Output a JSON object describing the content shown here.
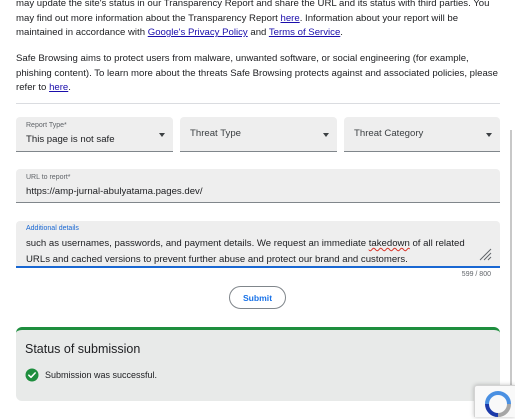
{
  "intro": {
    "text1": "may update the site's status in our Transparency Report and share the URL and its status with third parties. You may find out more information about the Transparency Report ",
    "link1": "here",
    "text2": ". Information about your report will be maintained in accordance with ",
    "link2": "Google's Privacy Policy",
    "text3": " and ",
    "link3": "Terms of Service",
    "text4": "."
  },
  "safe_browsing": {
    "text1": "Safe Browsing aims to protect users from malware, unwanted software, or social engineering (for example, phishing content). To learn more about the threats Safe Browsing protects against and associated policies, please refer to ",
    "link": "here",
    "text2": "."
  },
  "form": {
    "report_type": {
      "label": "Report Type*",
      "value": "This page is not safe"
    },
    "threat_type": {
      "placeholder": "Threat Type"
    },
    "threat_category": {
      "placeholder": "Threat Category"
    },
    "url": {
      "label": "URL to report*",
      "value": "https://amp-jurnal-abulyatama.pages.dev/"
    },
    "details": {
      "label": "Additional details",
      "value_part1": "such as usernames, passwords, and payment details. We request an immediate ",
      "value_misspelled": "takedown",
      "value_part2": " of all related URLs and cached versions to prevent further abuse and protect our brand and customers.",
      "counter": "599 / 800"
    },
    "submit_label": "Submit"
  },
  "status": {
    "title": "Status of submission",
    "message": "Submission was successful."
  },
  "colors": {
    "link": "#1a0dab",
    "accent": "#1a73e8",
    "success": "#1e8e3e"
  },
  "icons": [
    "dropdown-arrow-icon",
    "resize-handle-icon",
    "check-circle-icon",
    "recaptcha-logo-icon"
  ]
}
